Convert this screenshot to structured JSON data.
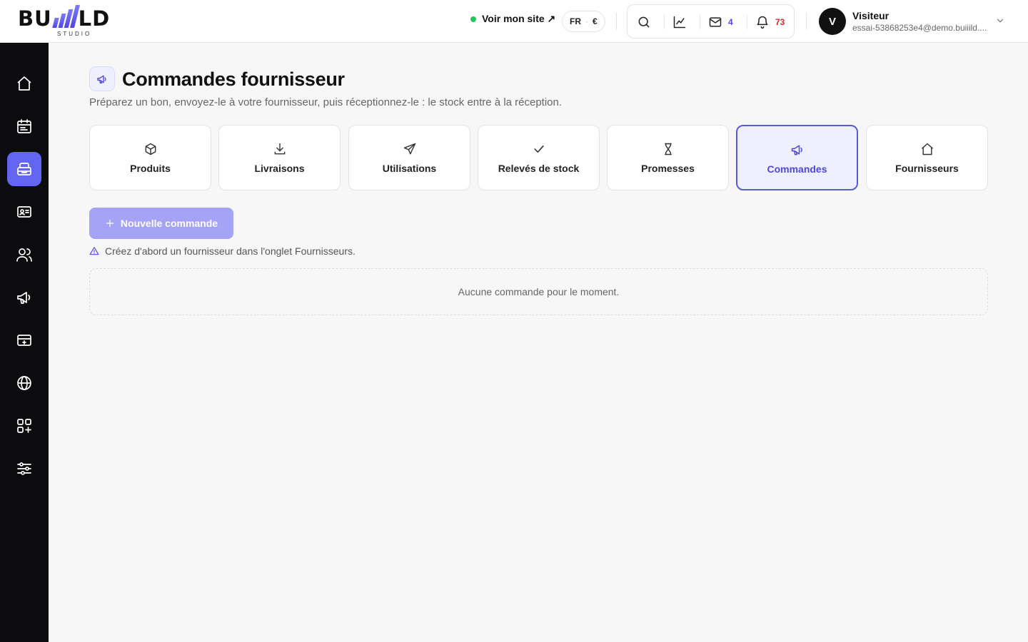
{
  "brand": {
    "logo_left": "BU",
    "logo_right": "LD",
    "logo_sub": "STUDIO"
  },
  "header": {
    "site_link": "Voir mon site ↗",
    "lang": "FR",
    "currency": "€",
    "messages_count": "4",
    "notifications_count": "73",
    "user_initial": "V",
    "user_name": "Visiteur",
    "user_email": "essai-53868253e4@demo.buiiild...."
  },
  "colors": {
    "accent": "#6366f1",
    "accent_text": "#4f46e5",
    "status_online": "#22c55e",
    "notif_badge": "#dc2626"
  },
  "sidebar": {
    "items": [
      {
        "icon": "home-icon"
      },
      {
        "icon": "calendar-icon"
      },
      {
        "icon": "inventory-icon",
        "active": true
      },
      {
        "icon": "contact-card-icon"
      },
      {
        "icon": "users-icon"
      },
      {
        "icon": "megaphone-icon"
      },
      {
        "icon": "payment-card-icon"
      },
      {
        "icon": "globe-icon"
      },
      {
        "icon": "apps-add-icon"
      },
      {
        "icon": "sliders-icon"
      }
    ]
  },
  "page": {
    "title": "Commandes fournisseur",
    "subtitle": "Préparez un bon, envoyez-le à votre fournisseur, puis réceptionnez-le : le stock entre à la réception.",
    "tabs": [
      {
        "label": "Produits",
        "icon": "box-icon"
      },
      {
        "label": "Livraisons",
        "icon": "download-icon"
      },
      {
        "label": "Utilisations",
        "icon": "send-icon"
      },
      {
        "label": "Relevés de stock",
        "icon": "check-icon"
      },
      {
        "label": "Promesses",
        "icon": "hourglass-icon"
      },
      {
        "label": "Commandes",
        "icon": "megaphone-icon",
        "active": true
      },
      {
        "label": "Fournisseurs",
        "icon": "home-icon"
      }
    ],
    "new_order_label": "Nouvelle commande",
    "warning": "Créez d'abord un fournisseur dans l'onglet Fournisseurs.",
    "empty_state": "Aucune commande pour le moment."
  }
}
